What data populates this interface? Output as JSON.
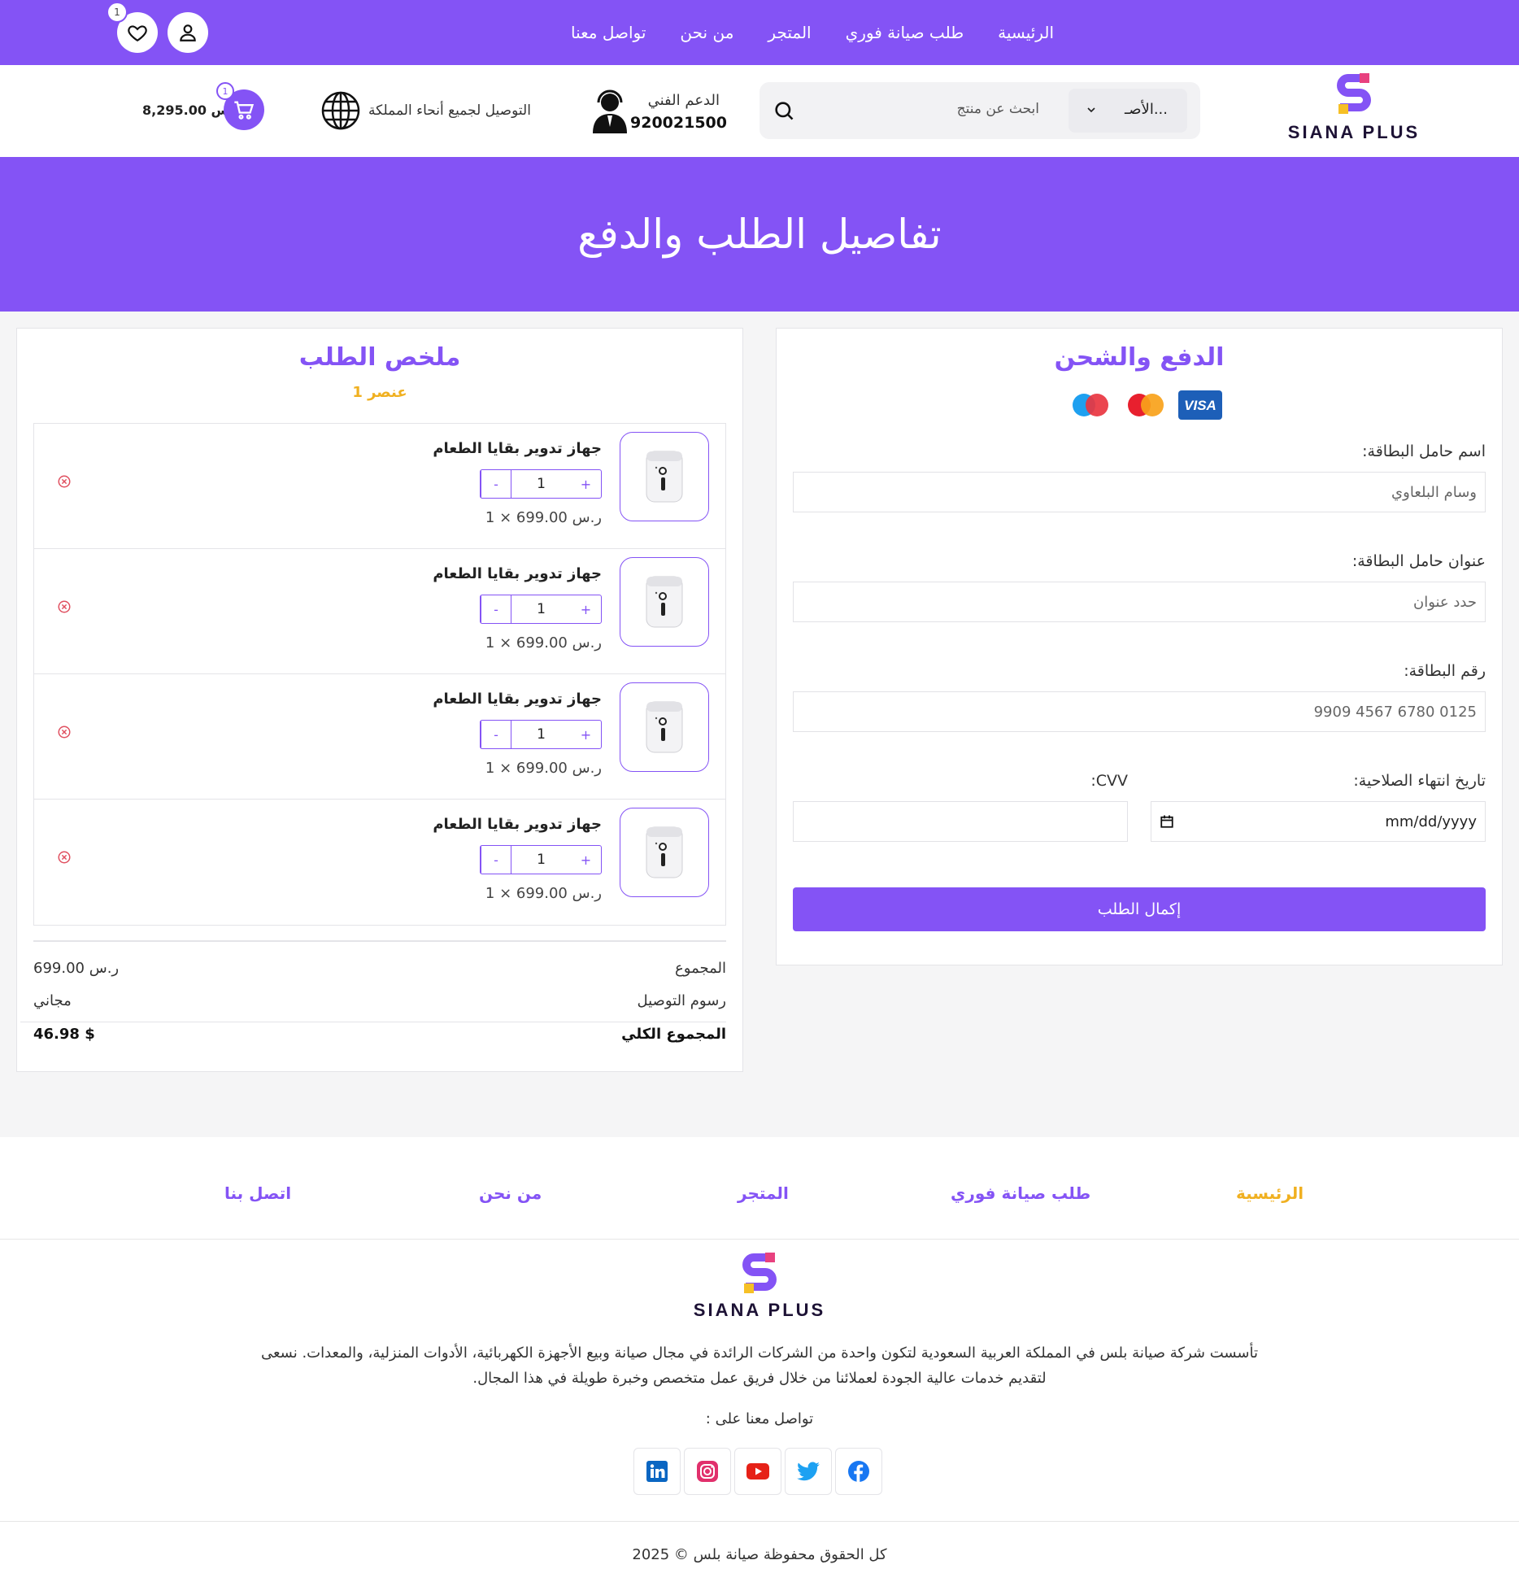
{
  "topnav": {
    "home": "الرئيسية",
    "maintenance": "طلب صيانة فوري",
    "shop": "المتجر",
    "about": "من نحن",
    "contact": "تواصل معنا"
  },
  "wishlist": {
    "count": "1"
  },
  "logo": {
    "text": "SIANA PLUS"
  },
  "search": {
    "category": "الأصـ...",
    "placeholder": "ابحث عن منتج"
  },
  "support": {
    "label": "الدعم الفني",
    "number": "920021500"
  },
  "shipping": {
    "text": "التوصيل لجميع أنحاء المملكة"
  },
  "cart": {
    "amount": "8,295.00 ر.س",
    "count": "1"
  },
  "hero": {
    "title": "تفاصيل الطلب والدفع"
  },
  "payment": {
    "title": "الدفع والشحن",
    "name_label": "اسم حامل البطاقة:",
    "name_placeholder": "وسام البلعاوي",
    "address_label": "عنوان حامل البطاقة:",
    "address_placeholder": "حدد عنوان",
    "number_label": "رقم البطاقة:",
    "number_placeholder": "9909 4567 6780 0125",
    "expiry_label": "تاريخ انتهاء الصلاحية:",
    "expiry_placeholder": "mm/dd/yyyy",
    "cvv_label": "CVV:",
    "submit": "إكمال الطلب",
    "card_brands": [
      "visa-icon",
      "mastercard-icon",
      "maestro-icon"
    ]
  },
  "summary": {
    "title": "ملخص الطلب",
    "count": "1 عنصر",
    "items": [
      {
        "name": "جهاز تدوير بقايا الطعام",
        "qty": "1",
        "price": "1 × 699.00 ر.س",
        "minus": "-",
        "plus": "+"
      },
      {
        "name": "جهاز تدوير بقايا الطعام",
        "qty": "1",
        "price": "1 × 699.00 ر.س",
        "minus": "-",
        "plus": "+"
      },
      {
        "name": "جهاز تدوير بقايا الطعام",
        "qty": "1",
        "price": "1 × 699.00 ر.س",
        "minus": "-",
        "plus": "+"
      },
      {
        "name": "جهاز تدوير بقايا الطعام",
        "qty": "1",
        "price": "1 × 699.00 ر.س",
        "minus": "-",
        "plus": "+"
      }
    ],
    "subtotal_label": "المجموع",
    "subtotal": "699.00 ر.س",
    "delivery_label": "رسوم التوصيل",
    "delivery": "مجاني",
    "total_label": "المجموع الكلي",
    "total": "46.98 $"
  },
  "footnav": {
    "home": "الرئيسية",
    "maintenance": "طلب صيانة فوري",
    "shop": "المتجر",
    "about": "من نحن",
    "contact": "اتصل بنا"
  },
  "footer": {
    "about": "تأسست شركة صيانة بلس في المملكة العربية السعودية لتكون واحدة من الشركات الرائدة في مجال صيانة وبيع الأجهزة الكهربائية، الأدوات المنزلية، والمعدات. نسعى لتقديم خدمات عالية الجودة لعملائنا من خلال فريق عمل متخصص وخبرة طويلة في هذا المجال.",
    "contact_label": "تواصل معنا على :",
    "copyright": "كل الحقوق محفوظة صيانة بلس © 2025"
  },
  "colors": {
    "accent": "#8453f5",
    "highlight": "#f0b020",
    "remove": "#e05060"
  }
}
